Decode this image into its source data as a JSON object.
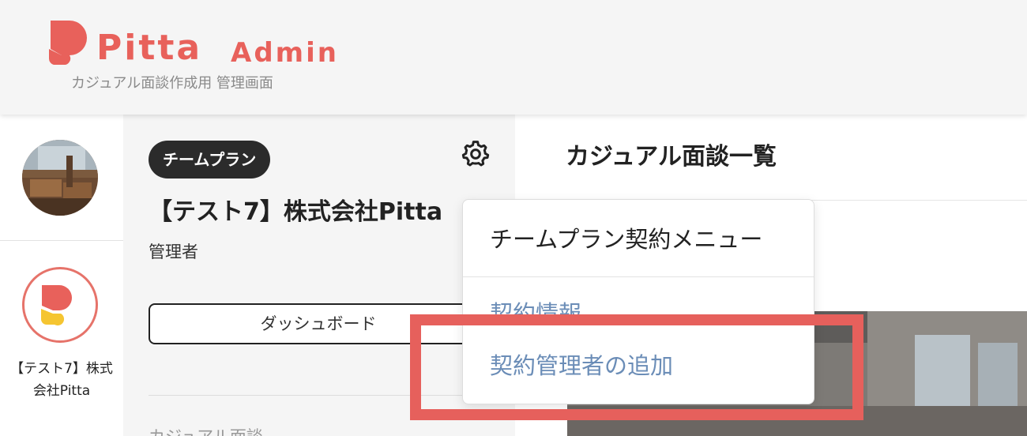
{
  "colors": {
    "brand": "#e8615b",
    "brand_accent": "#f5c531",
    "menu_link": "#6b8db7",
    "highlight": "#e6605c",
    "header_bg": "#f5f5f5"
  },
  "header": {
    "logo_text": "Pitta",
    "logo_admin": "Admin",
    "subtitle": "カジュアル面談作成用 管理画面"
  },
  "rail": {
    "avatar_icon": "user-photo-avatar",
    "company_icon": "pitta-logo-icon",
    "company_name": "【テスト7】株式会社Pitta"
  },
  "panel": {
    "plan_badge": "チームプラン",
    "company_title": "【テスト7】株式会社Pitta",
    "role": "管理者",
    "dashboard_button": "ダッシュボード",
    "settings_icon": "gear-icon",
    "cut_off_text": "カジュアル面談"
  },
  "main": {
    "title": "カジュアル面談一覧"
  },
  "menu": {
    "header": "チームプラン契約メニュー",
    "items": [
      {
        "label": "契約情報"
      },
      {
        "label": "契約管理者の追加"
      }
    ]
  }
}
